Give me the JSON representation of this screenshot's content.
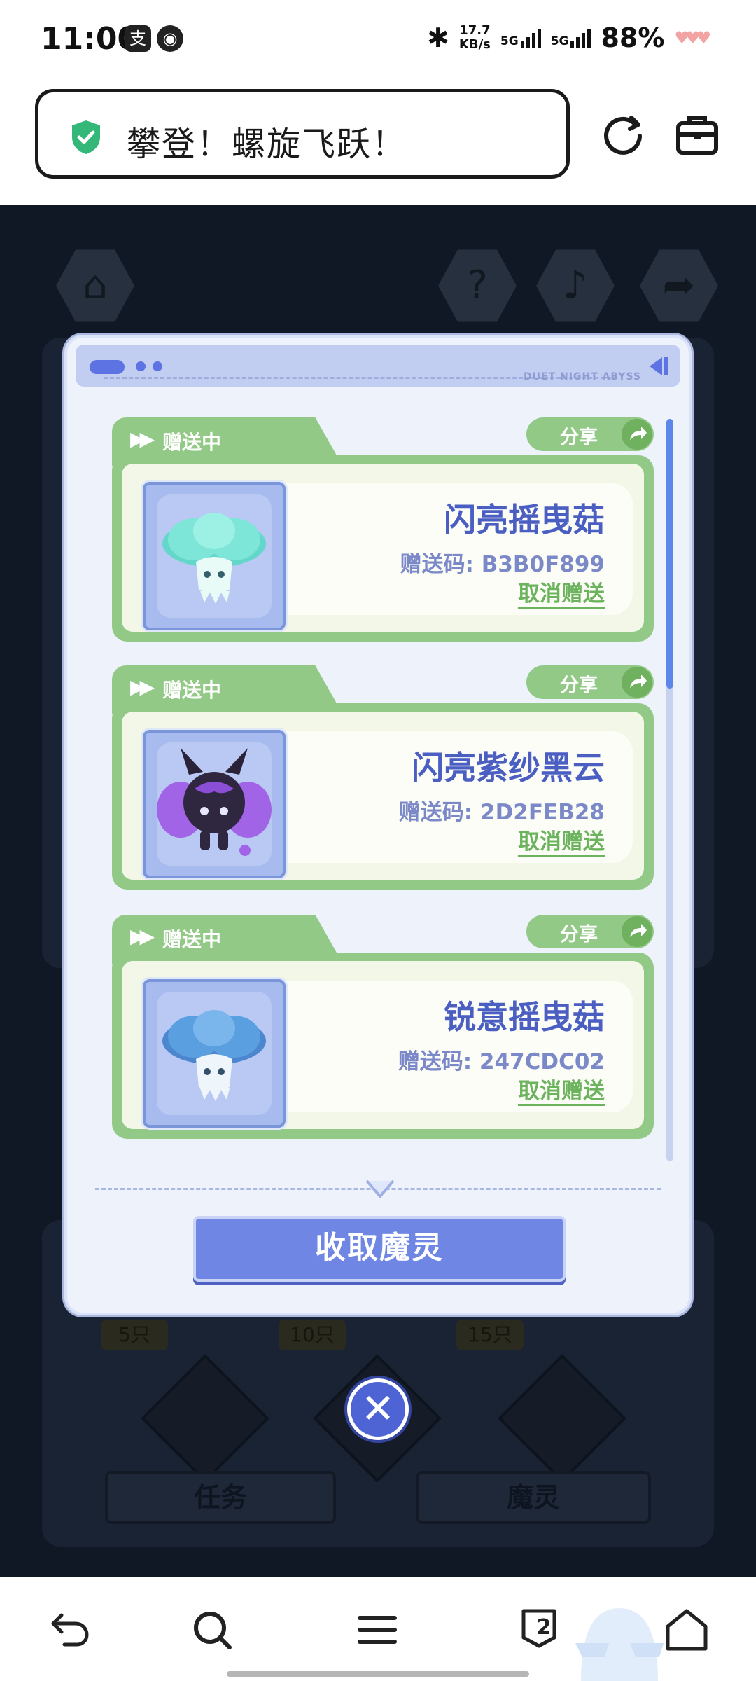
{
  "status_bar": {
    "time": "11:00",
    "network_speed_value": "17.7",
    "network_speed_unit": "KB/s",
    "sim1": "5G",
    "sim2": "5G",
    "battery": "88%"
  },
  "browser": {
    "page_title": "攀登！螺旋飞跃！",
    "reload_icon": "reload-icon",
    "toolbox_icon": "toolbox-icon"
  },
  "dialog": {
    "header_brand": "DUET NIGHT ABYSS",
    "collect_button": "收取魔灵",
    "cards": [
      {
        "status": "赠送中",
        "share": "分享",
        "name": "闪亮摇曳菇",
        "code": "赠送码: B3B0F899",
        "cancel": "取消赠送",
        "art_color": "#63d7c9"
      },
      {
        "status": "赠送中",
        "share": "分享",
        "name": "闪亮紫纱黑云",
        "code": "赠送码: 2D2FEB28",
        "cancel": "取消赠送",
        "art_color": "#8a4fd6"
      },
      {
        "status": "赠送中",
        "share": "分享",
        "name": "锐意摇曳菇",
        "code": "赠送码: 247CDC02",
        "cancel": "取消赠送",
        "art_color": "#5a9fe0"
      }
    ]
  },
  "background_game": {
    "milestones": [
      "5只",
      "10只",
      "15只"
    ],
    "tab_task": "任务",
    "tab_spirit": "魔灵"
  },
  "navbar": {
    "tab_count": "2"
  },
  "colors": {
    "accent_blue": "#5d72e3",
    "card_green": "#93c987",
    "name_text": "#4b5ec2"
  }
}
